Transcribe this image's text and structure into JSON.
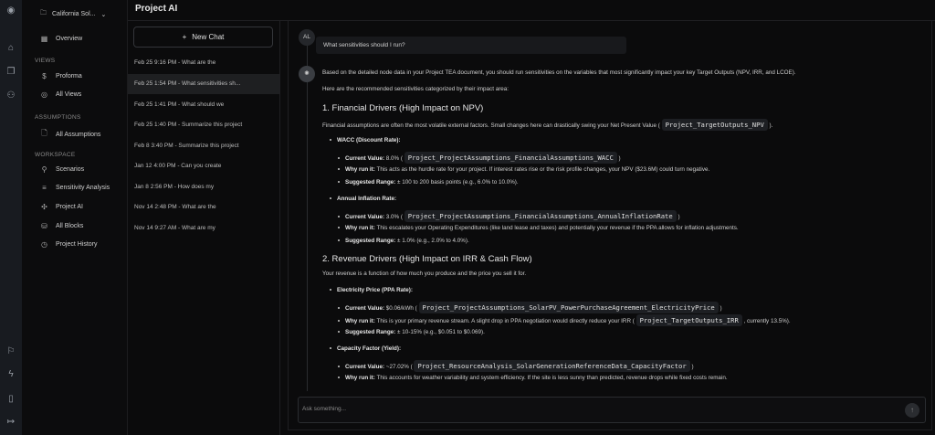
{
  "app": {
    "title": "Project AI"
  },
  "rail": {
    "icons": [
      "logo-icon",
      "home-icon",
      "projects-icon",
      "users-icon",
      "flag-icon",
      "bolt-icon",
      "book-icon",
      "logout-icon"
    ]
  },
  "sidebar": {
    "project": "California Sol...",
    "overview": "Overview",
    "sections": {
      "views": "VIEWS",
      "assumptions": "ASSUMPTIONS",
      "workspace": "WORKSPACE"
    },
    "items": [
      {
        "label": "Proforma"
      },
      {
        "label": "All Views"
      },
      {
        "label": "All Assumptions"
      },
      {
        "label": "Scenarios"
      },
      {
        "label": "Sensitivity Analysis"
      },
      {
        "label": "Project AI"
      },
      {
        "label": "All Blocks"
      },
      {
        "label": "Project History"
      }
    ]
  },
  "chats": {
    "new_chat": "New Chat",
    "items": [
      "Feb 25 9:16 PM - What are the",
      "Feb 25 1:54 PM - What sensitivities sh...",
      "Feb 25 1:41 PM - What should we",
      "Feb 25 1:40 PM - Summarize this project",
      "Feb 8 3:40 PM - Summarize this project",
      "Jan 12 4:00 PM - Can you create",
      "Jan 8 2:56 PM - How does my",
      "Nov 14 2:48 PM - What are the",
      "Nov 14 9:27 AM - What are my"
    ]
  },
  "conversation": {
    "user_initials": "AL",
    "user_message": "What sensitivities should I run?",
    "r": {
      "intro": "Based on the detailed node data in your Project TEA document, you should run sensitivities on the variables that most significantly impact your key Target Outputs (NPV, IRR, and LCOE).",
      "intro2": "Here are the recommended sensitivities categorized by their impact area:",
      "h1": "1. Financial Drivers (High Impact on NPV)",
      "p1": "Financial assumptions are often the most volatile external factors. Small changes here can drastically swing your Net Present Value (",
      "p1_code": "Project_TargetOutputs_NPV",
      "wacc": "WACC (Discount Rate):",
      "cv_label": "Current Value:",
      "why_label": "Why run it:",
      "range_label": "Suggested Range:",
      "wacc_cv": "8.0% (",
      "wacc_code": "Project_ProjectAssumptions_FinancialAssumptions_WACC",
      "wacc_why": "This acts as the hurdle rate for your project. If interest rates rise or the risk profile changes, your NPV ($23.6M) could turn negative.",
      "wacc_range": "± 100 to 200 basis points (e.g., 6.0% to 10.0%).",
      "infl": "Annual Inflation Rate:",
      "infl_cv": "3.0% (",
      "infl_code": "Project_ProjectAssumptions_FinancialAssumptions_AnnualInflationRate",
      "infl_why": "This escalates your Operating Expenditures (like land lease and taxes) and potentially your revenue if the PPA allows for inflation adjustments.",
      "infl_range": "± 1.0% (e.g., 2.0% to 4.0%).",
      "h2": "2. Revenue Drivers (High Impact on IRR & Cash Flow)",
      "p2": "Your revenue is a function of how much you produce and the price you sell it for.",
      "ppa": "Electricity Price (PPA Rate):",
      "ppa_cv": "$0.06/kWh (",
      "ppa_code": "Project_ProjectAssumptions_SolarPV_PowerPurchaseAgreement_ElectricityPrice",
      "ppa_why": "This is your primary revenue stream. A slight drop in PPA negotiation would directly reduce your IRR (",
      "ppa_why_code": "Project_TargetOutputs_IRR",
      "ppa_why_end": ", currently 13.5%).",
      "ppa_range": "± 10-15% (e.g., $0.051 to $0.069).",
      "cf": "Capacity Factor (Yield):",
      "cf_cv": "~27.02% (",
      "cf_code": "Project_ResourceAnalysis_SolarGenerationReferenceData_CapacityFactor",
      "cf_why": "This accounts for weather variability and system efficiency. If the site is less sunny than predicted, revenue drops while fixed costs remain.",
      "close": ")",
      "close_dot": ")."
    }
  },
  "input": {
    "placeholder": "Ask something..."
  }
}
